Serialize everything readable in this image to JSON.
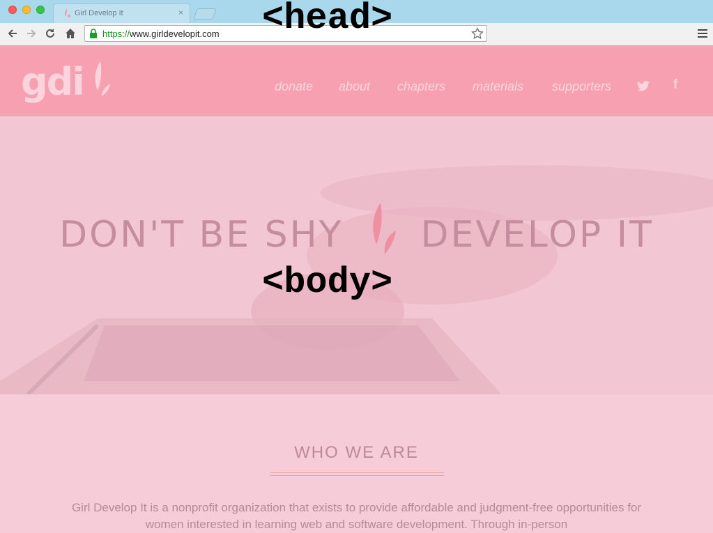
{
  "browser": {
    "tab_title": "Girl Develop It",
    "tab_close": "×",
    "url_scheme": "https://",
    "url_host": "www.girldevelopit.com"
  },
  "site": {
    "logo_text": "gdi",
    "nav": [
      "donate",
      "about",
      "chapters",
      "materials",
      "supporters"
    ],
    "social": [
      "twitter-icon",
      "facebook-icon"
    ],
    "facebook_glyph": "f"
  },
  "hero": {
    "headline_left": "DON'T BE SHY",
    "headline_right": "DEVELOP IT"
  },
  "overlay": {
    "head_label": "<head>",
    "body_label": "<body>"
  },
  "who": {
    "title": "WHO WE ARE",
    "text": "Girl Develop It is a nonprofit organization that exists to provide affordable and judgment-free opportunities for women interested in learning web and software development. Through in-person"
  },
  "colors": {
    "header_bg": "#f7a0b1",
    "hero_bg": "#f3c6d3",
    "page_bg": "#f7ccd9",
    "accent_drop": "#ee8fa2",
    "tabbar_bg": "#a9d8ec"
  }
}
